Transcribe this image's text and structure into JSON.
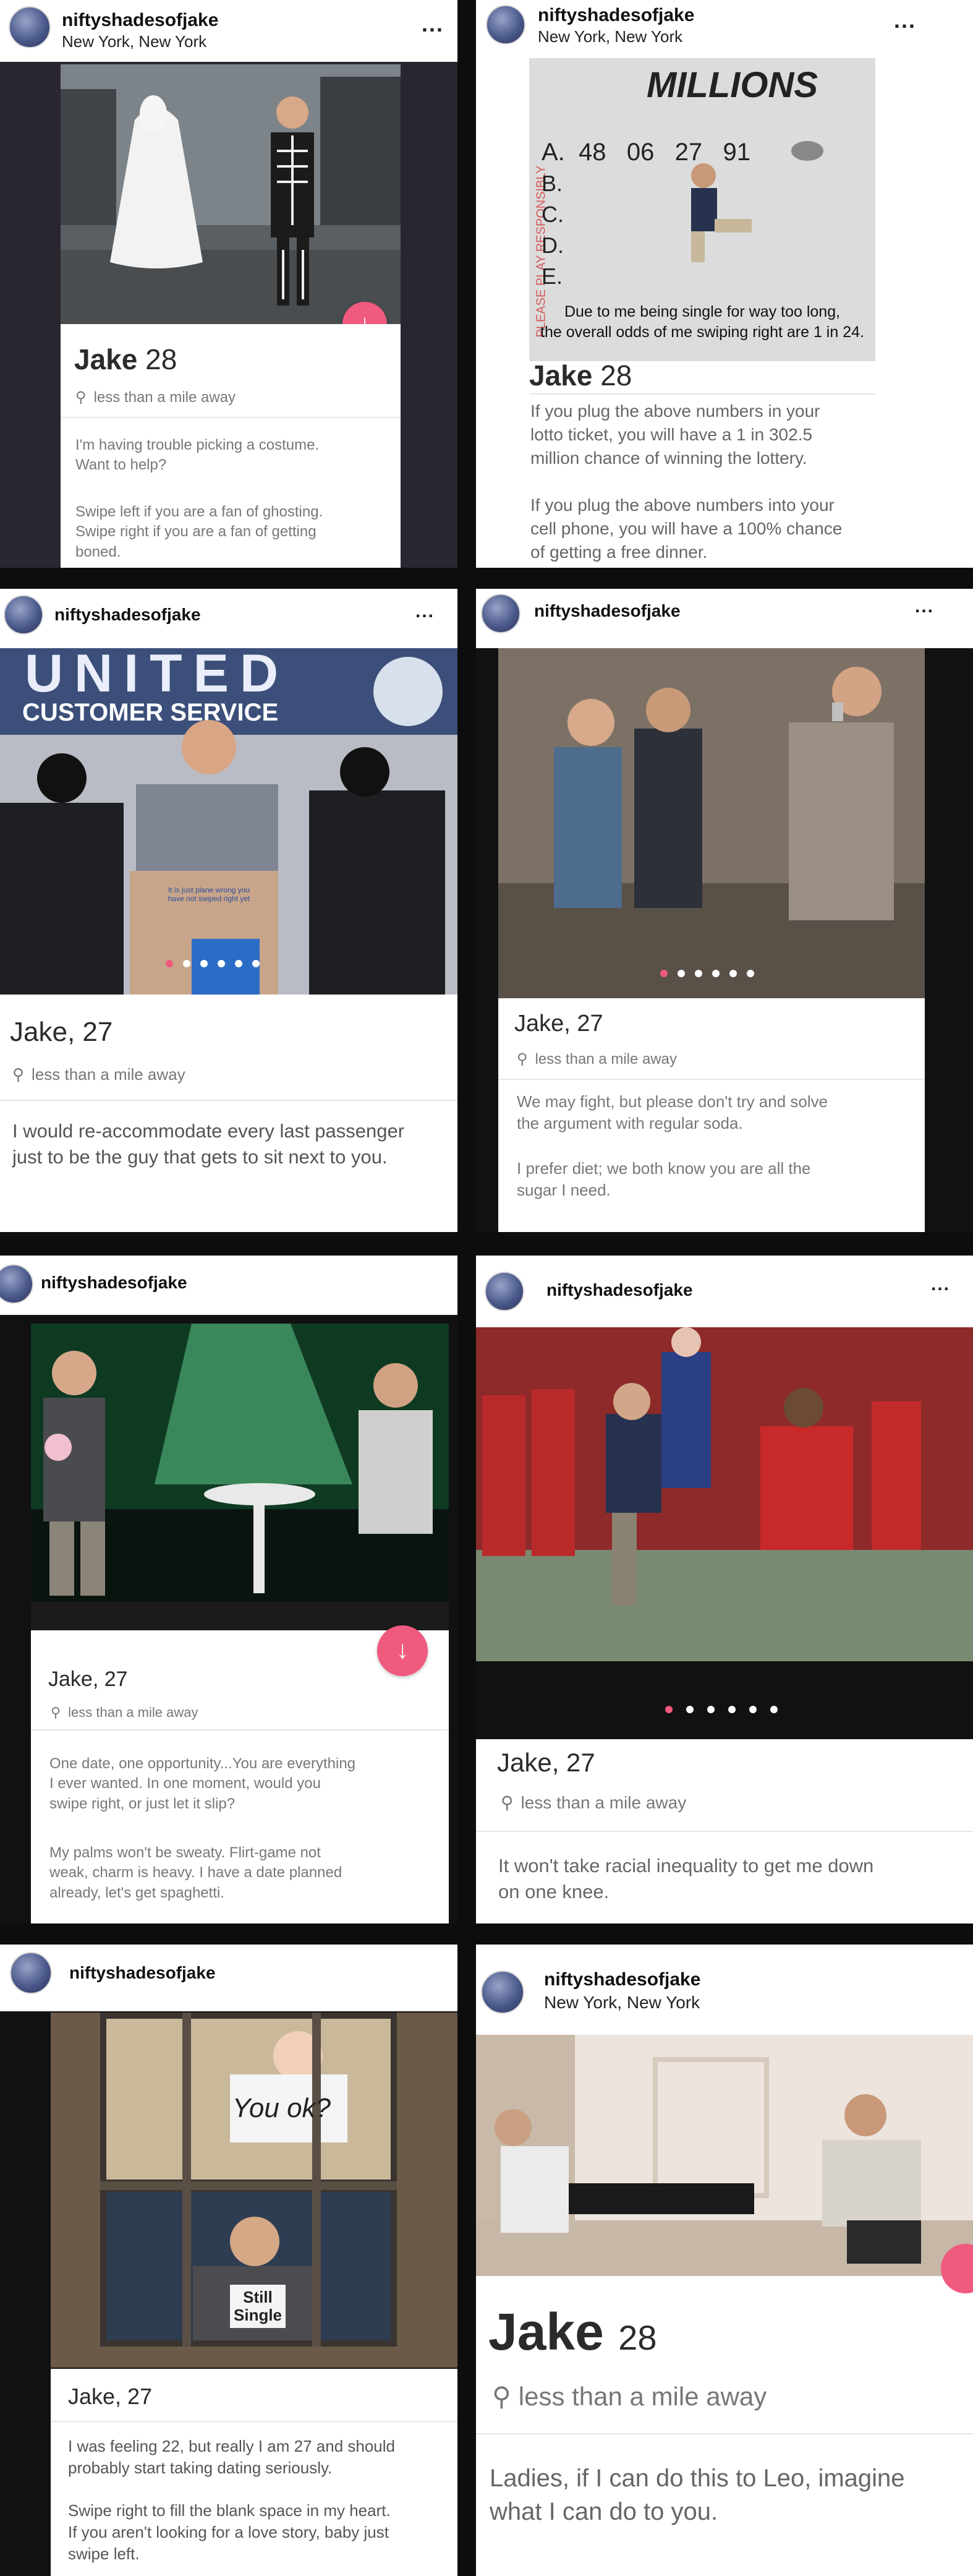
{
  "tiles": [
    {
      "username": "niftyshadesofjake",
      "location": "New York, New York",
      "more": "...",
      "name": "Jake",
      "age": "28",
      "distance": "less than a mile away",
      "bio1": "I'm having trouble picking a costume.\nWant to help?",
      "bio2": "Swipe left if you are a fan of ghosting.\nSwipe right if you are a fan of getting\nboned."
    },
    {
      "username": "niftyshadesofjake",
      "location": "New York, New York",
      "more": "...",
      "ticket_brand": "MILLIONS",
      "ticket_side": "PLEASE PLAY RESPONSIBLY",
      "ticket_rows": [
        "A.  48   06   27   91",
        "B.",
        "C.",
        "D.",
        "E."
      ],
      "ticket_caption": "Due to me being single for way too long,\nthe overall odds of me swiping right are 1 in 24.",
      "name": "Jake",
      "age": "28",
      "bio1": "If you plug the above numbers in your\nlotto ticket, you will have a 1 in 302.5\nmillion chance of winning the lottery.",
      "bio2": "If you plug the above numbers into your\ncell phone, you will have a 100% chance\nof getting a free dinner."
    },
    {
      "username": "niftyshadesofjake",
      "more": "...",
      "banner": "UNITED",
      "banner_sub": "CUSTOMER SERVICE",
      "podium_text": "It is just plane wrong you\nhave not swiped right yet",
      "name": "Jake, 27",
      "distance": "less than a mile away",
      "bio1": "I would re-accommodate every last passenger\njust to be the guy that gets to sit next to you."
    },
    {
      "username": "niftyshadesofjake",
      "more": "...",
      "name": "Jake, 27",
      "distance": "less than a mile away",
      "bio1": "We may fight, but please don't try and solve\nthe argument with regular soda.",
      "bio2": "I prefer diet; we both know you are all the\nsugar I need."
    },
    {
      "username": "niftyshadesofjake",
      "name": "Jake, 27",
      "distance": "less than a mile away",
      "bio1": "One date, one opportunity...You are everything\nI ever wanted. In one moment, would you\nswipe right, or just let it slip?",
      "bio2": "My palms won't be sweaty. Flirt-game not\nweak, charm is heavy. I have a date planned\nalready, let's get spaghetti."
    },
    {
      "username": "niftyshadesofjake",
      "more": "...",
      "name": "Jake, 27",
      "distance": "less than a mile away",
      "bio1": "It won't take racial inequality to get me down\non one knee."
    },
    {
      "username": "niftyshadesofjake",
      "sign1": "You ok?",
      "sign2": "Still\nSingle",
      "name": "Jake, 27",
      "bio1": "I was feeling 22, but really I am 27 and should\nprobably start taking dating seriously.",
      "bio2": "Swipe right to fill the blank space in my heart.\nIf you aren't looking for a love story, baby just\nswipe left."
    },
    {
      "username": "niftyshadesofjake",
      "location": "New York, New York",
      "name": "Jake",
      "age": "28",
      "distance": "less than a mile away",
      "bio1": "Ladies, if I can do this to Leo, imagine\nwhat I can do to you."
    }
  ],
  "colors": {
    "accent": "#f05a7e",
    "text": "#2b2b2b",
    "muted": "#777777"
  },
  "icons": {
    "pin": "map-pin-icon",
    "like": "arrow-down-icon",
    "avatar": "avatar"
  }
}
